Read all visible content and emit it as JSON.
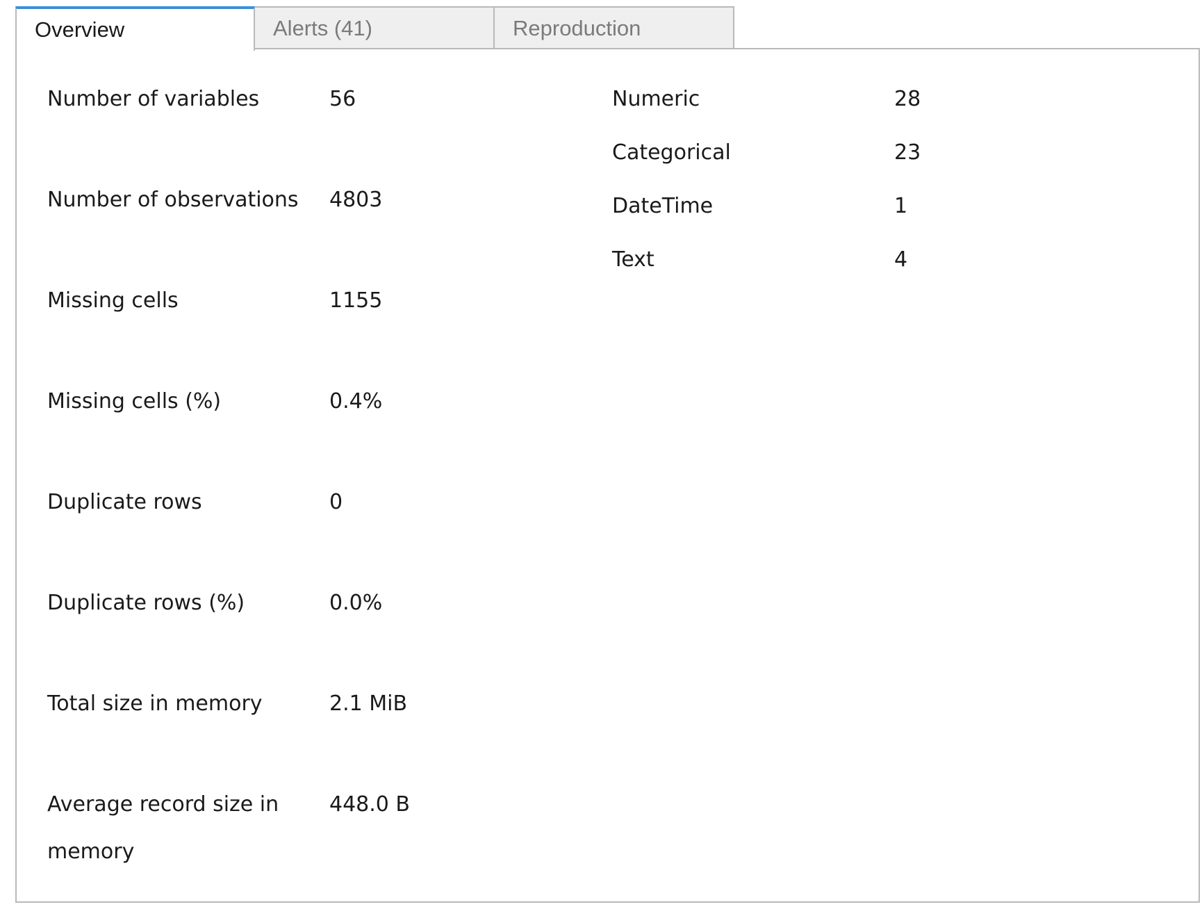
{
  "tabs": [
    {
      "label": "Overview",
      "active": true
    },
    {
      "label": "Alerts (41)",
      "active": false
    },
    {
      "label": "Reproduction",
      "active": false
    }
  ],
  "dataset_statistics": [
    {
      "label": "Number of variables",
      "value": "56"
    },
    {
      "label": "Number of observations",
      "value": "4803"
    },
    {
      "label": "Missing cells",
      "value": "1155"
    },
    {
      "label": "Missing cells (%)",
      "value": "0.4%"
    },
    {
      "label": "Duplicate rows",
      "value": "0"
    },
    {
      "label": "Duplicate rows (%)",
      "value": "0.0%"
    },
    {
      "label": "Total size in memory",
      "value": "2.1 MiB"
    },
    {
      "label": "Average record size in memory",
      "value": "448.0 B"
    }
  ],
  "variable_types": [
    {
      "label": "Numeric",
      "value": "28"
    },
    {
      "label": "Categorical",
      "value": "23"
    },
    {
      "label": "DateTime",
      "value": "1"
    },
    {
      "label": "Text",
      "value": "4"
    }
  ],
  "colors": {
    "active_tab_accent": "#3a8fdc",
    "inactive_tab_bg": "#efefef",
    "border": "#b9b9b9"
  }
}
